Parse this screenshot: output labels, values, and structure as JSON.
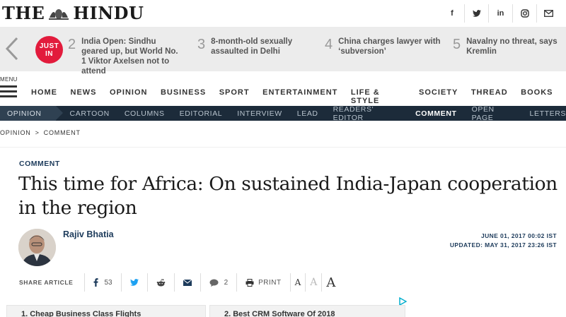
{
  "site": {
    "logo_left": "THE",
    "logo_right": "HINDU"
  },
  "social": [
    {
      "icon": "facebook-icon",
      "glyph": "f"
    },
    {
      "icon": "twitter-icon",
      "glyph": "🐦"
    },
    {
      "icon": "linkedin-icon",
      "glyph": "in"
    },
    {
      "icon": "instagram-icon",
      "glyph": "◎"
    },
    {
      "icon": "email-icon",
      "glyph": "✉"
    }
  ],
  "trending": {
    "badge": "JUST IN",
    "items": [
      {
        "num": "2",
        "text": "India Open: Sindhu geared up, but World No. 1 Viktor Axelsen not to attend"
      },
      {
        "num": "3",
        "text": "8-month-old sexually assaulted in Delhi"
      },
      {
        "num": "4",
        "text": "China charges lawyer with ‘subversion’"
      },
      {
        "num": "5",
        "text": "Navalny no threat, says Kremlin"
      }
    ]
  },
  "menu": {
    "label": "MENU"
  },
  "main_nav": [
    "HOME",
    "NEWS",
    "OPINION",
    "BUSINESS",
    "SPORT",
    "ENTERTAINMENT",
    "LIFE & STYLE",
    "SOCIETY",
    "THREAD",
    "BOOKS"
  ],
  "sub_nav": {
    "section": "OPINION",
    "items": [
      "CARTOON",
      "COLUMNS",
      "EDITORIAL",
      "INTERVIEW",
      "LEAD",
      "READERS' EDITOR",
      "COMMENT",
      "OPEN PAGE",
      "LETTERS"
    ],
    "active": "COMMENT"
  },
  "breadcrumb": {
    "first": "OPINION",
    "sep": ">",
    "second": "COMMENT"
  },
  "article": {
    "kicker": "COMMENT",
    "headline": "This time for Africa: On sustained India-Japan cooperation in the region",
    "author": "Rajiv Bhatia",
    "published": "JUNE 01, 2017 00:02 IST",
    "updated": "UPDATED: MAY 31, 2017 23:26 IST"
  },
  "share": {
    "label": "SHARE ARTICLE",
    "facebook_count": "53",
    "comment_count": "2",
    "print_label": "PRINT",
    "font_small": "A",
    "font_medium": "A",
    "font_large": "A"
  },
  "ads": [
    {
      "text": "1.   Cheap Business Class Flights"
    },
    {
      "text": "2.   Best CRM Software Of 2018"
    }
  ],
  "colors": {
    "accent": "#e21b3c",
    "navy": "#1c2b3a",
    "link": "#1d3b5b",
    "ad_choice": "#00aecd"
  }
}
